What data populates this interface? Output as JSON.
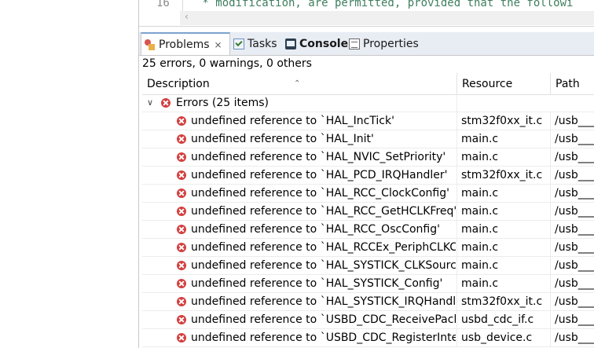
{
  "editor": {
    "line_number": "16",
    "code_line": " * modification, are permitted, provided that the followi"
  },
  "tabs": [
    {
      "label": "Problems",
      "icon": "problems-icon",
      "active": true
    },
    {
      "label": "Tasks",
      "icon": "tasks-icon"
    },
    {
      "label": "Console",
      "icon": "console-icon"
    },
    {
      "label": "Properties",
      "icon": "properties-icon"
    }
  ],
  "problems": {
    "summary": "25 errors, 0 warnings, 0 others",
    "columns": {
      "description": "Description",
      "resource": "Resource",
      "path": "Path"
    },
    "group": {
      "label": "Errors (25 items)"
    },
    "rows": [
      {
        "description": "undefined reference to `HAL_IncTick'",
        "resource": "stm32f0xx_it.c",
        "path": "/usb___/"
      },
      {
        "description": "undefined reference to `HAL_Init'",
        "resource": "main.c",
        "path": "/usb___/"
      },
      {
        "description": "undefined reference to `HAL_NVIC_SetPriority'",
        "resource": "main.c",
        "path": "/usb___/"
      },
      {
        "description": "undefined reference to `HAL_PCD_IRQHandler'",
        "resource": "stm32f0xx_it.c",
        "path": "/usb___/"
      },
      {
        "description": "undefined reference to `HAL_RCC_ClockConfig'",
        "resource": "main.c",
        "path": "/usb___/"
      },
      {
        "description": "undefined reference to `HAL_RCC_GetHCLKFreq'",
        "resource": "main.c",
        "path": "/usb___/"
      },
      {
        "description": "undefined reference to `HAL_RCC_OscConfig'",
        "resource": "main.c",
        "path": "/usb___/"
      },
      {
        "description": "undefined reference to `HAL_RCCEx_PeriphCLKConf",
        "resource": "main.c",
        "path": "/usb___/"
      },
      {
        "description": "undefined reference to `HAL_SYSTICK_CLKSourceCo",
        "resource": "main.c",
        "path": "/usb___/"
      },
      {
        "description": "undefined reference to `HAL_SYSTICK_Config'",
        "resource": "main.c",
        "path": "/usb___/"
      },
      {
        "description": "undefined reference to `HAL_SYSTICK_IRQHandler'",
        "resource": "stm32f0xx_it.c",
        "path": "/usb___/"
      },
      {
        "description": "undefined reference to `USBD_CDC_ReceivePacket'",
        "resource": "usbd_cdc_if.c",
        "path": "/usb___/"
      },
      {
        "description": "undefined reference to `USBD_CDC_RegisterInterfac",
        "resource": "usb_device.c",
        "path": "/usb___/"
      }
    ]
  }
}
